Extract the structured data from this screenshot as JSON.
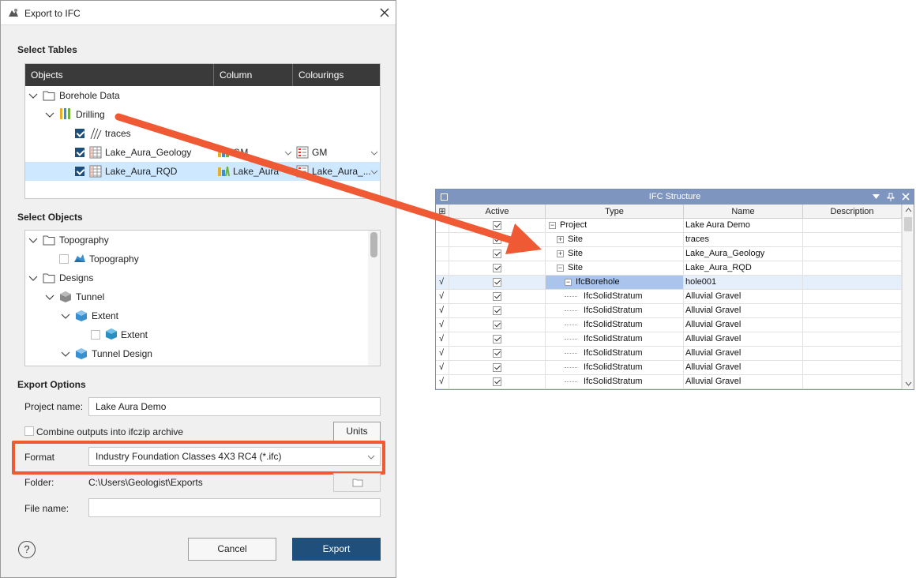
{
  "window": {
    "title": "Export to IFC"
  },
  "select_tables": {
    "label": "Select Tables",
    "columns": [
      "Objects",
      "Column",
      "Colourings"
    ],
    "rows": [
      {
        "label": "Borehole Data"
      },
      {
        "label": "Drilling"
      },
      {
        "label": "traces"
      },
      {
        "label": "Lake_Aura_Geology",
        "column": "GM",
        "colouring": "GM"
      },
      {
        "label": "Lake_Aura_RQD",
        "column": "Lake_Aura_...",
        "colouring": "Lake_Aura_..."
      }
    ]
  },
  "select_objects": {
    "label": "Select Objects",
    "rows": [
      {
        "label": "Topography"
      },
      {
        "label": "Topography"
      },
      {
        "label": "Designs"
      },
      {
        "label": "Tunnel"
      },
      {
        "label": "Extent"
      },
      {
        "label": "Extent"
      },
      {
        "label": "Tunnel Design"
      }
    ]
  },
  "export_options": {
    "label": "Export Options",
    "project_name_label": "Project name:",
    "project_name_value": "Lake Aura Demo",
    "combine_label": "Combine outputs into ifczip archive",
    "units_button": "Units",
    "format_label": "Format",
    "format_value": "Industry Foundation Classes 4X3 RC4 (*.ifc)",
    "folder_label": "Folder:",
    "folder_value": "C:\\Users\\Geologist\\Exports",
    "file_name_label": "File name:",
    "file_name_value": ""
  },
  "footer": {
    "help": "?",
    "cancel": "Cancel",
    "export": "Export"
  },
  "ifc_structure": {
    "title": "IFC Structure",
    "columns": [
      "Active",
      "Type",
      "Name",
      "Description"
    ],
    "rows": [
      {
        "mark": "",
        "type": "Project",
        "name": "Lake Aura Demo"
      },
      {
        "mark": "",
        "type": "Site",
        "name": "traces"
      },
      {
        "mark": "",
        "type": "Site",
        "name": "Lake_Aura_Geology"
      },
      {
        "mark": "",
        "type": "Site",
        "name": "Lake_Aura_RQD"
      },
      {
        "mark": "√",
        "type": "IfcBorehole",
        "name": "hole001"
      },
      {
        "mark": "√",
        "type": "IfcSolidStratum",
        "name": "Alluvial Gravel"
      },
      {
        "mark": "√",
        "type": "IfcSolidStratum",
        "name": "Alluvial Gravel"
      },
      {
        "mark": "√",
        "type": "IfcSolidStratum",
        "name": "Alluvial Gravel"
      },
      {
        "mark": "√",
        "type": "IfcSolidStratum",
        "name": "Alluvial Gravel"
      },
      {
        "mark": "√",
        "type": "IfcSolidStratum",
        "name": "Alluvial Gravel"
      },
      {
        "mark": "√",
        "type": "IfcSolidStratum",
        "name": "Alluvial Gravel"
      },
      {
        "mark": "√",
        "type": "IfcSolidStratum",
        "name": "Alluvial Gravel"
      }
    ]
  },
  "colors": {
    "accent": "#1f4f7a",
    "highlight": "#ef5a35",
    "selection": "#cde8ff",
    "ifc_title": "#7e95c0"
  }
}
